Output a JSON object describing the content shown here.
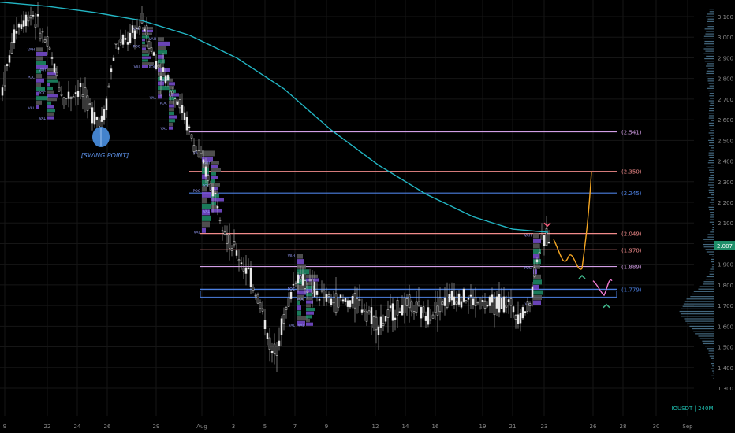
{
  "chart_data": {
    "type": "candlestick",
    "symbol_label": "IOUSDT | 240M",
    "annotation": "[SWING POINT]",
    "y_ticks": [
      "3.100",
      "3.000",
      "2.900",
      "2.800",
      "2.700",
      "2.600",
      "2.500",
      "2.400",
      "2.300",
      "2.200",
      "2.100",
      "2.000",
      "1.900",
      "1.800",
      "1.700",
      "1.600",
      "1.500",
      "1.400",
      "1.300"
    ],
    "y_tick_values": [
      3.1,
      3.0,
      2.9,
      2.8,
      2.7,
      2.6,
      2.5,
      2.4,
      2.3,
      2.2,
      2.1,
      2.0,
      1.9,
      1.8,
      1.7,
      1.6,
      1.5,
      1.4,
      1.3
    ],
    "ylim": [
      1.25,
      3.17
    ],
    "x_ticks": [
      "9",
      "22",
      "24",
      "26",
      "29",
      "Aug",
      "3",
      "5",
      "7",
      "9",
      "12",
      "14",
      "16",
      "19",
      "21",
      "23",
      "26",
      "28",
      "30",
      "Sep"
    ],
    "current_price": "2.007",
    "current_price_value": 2.007,
    "levels": [
      {
        "label": "(2.541)",
        "value": 2.541,
        "color": "#d29ee6"
      },
      {
        "label": "(2.350)",
        "value": 2.35,
        "color": "#f28b8b"
      },
      {
        "label": "(2.245)",
        "value": 2.245,
        "color": "#4c7fe0"
      },
      {
        "label": "(2.049)",
        "value": 2.049,
        "color": "#f28b8b"
      },
      {
        "label": "(1.970)",
        "value": 1.97,
        "color": "#f28b8b"
      },
      {
        "label": "(1.889)",
        "value": 1.889,
        "color": "#d29ee6"
      },
      {
        "label": "(1.779)",
        "value": 1.779,
        "color": "#4c7fe0"
      }
    ],
    "ma_line": {
      "color": "#22b6c4",
      "points": [
        [
          0,
          3.17
        ],
        [
          60,
          3.15
        ],
        [
          120,
          3.12
        ],
        [
          180,
          3.08
        ],
        [
          240,
          3.01
        ],
        [
          300,
          2.9
        ],
        [
          360,
          2.75
        ],
        [
          420,
          2.55
        ],
        [
          480,
          2.38
        ],
        [
          540,
          2.24
        ],
        [
          600,
          2.13
        ],
        [
          650,
          2.07
        ],
        [
          695,
          2.055
        ]
      ]
    },
    "profile_labels": {
      "vah": "VAH",
      "poc": "POC",
      "val": "VAL"
    },
    "colors": {
      "bull": "#e8e8e8",
      "bear": "#e8e8e8",
      "grid": "#161616",
      "axis_text": "#8a8a8a",
      "profile_green": "#1f8f6a",
      "profile_purple": "#7b4fd6",
      "projection_orange": "#f5a623",
      "projection_pink": "#f07ad0",
      "arrow_red": "#f25c7a",
      "arrow_green": "#3fb58a",
      "swing_circle": "#4a90e2"
    }
  }
}
